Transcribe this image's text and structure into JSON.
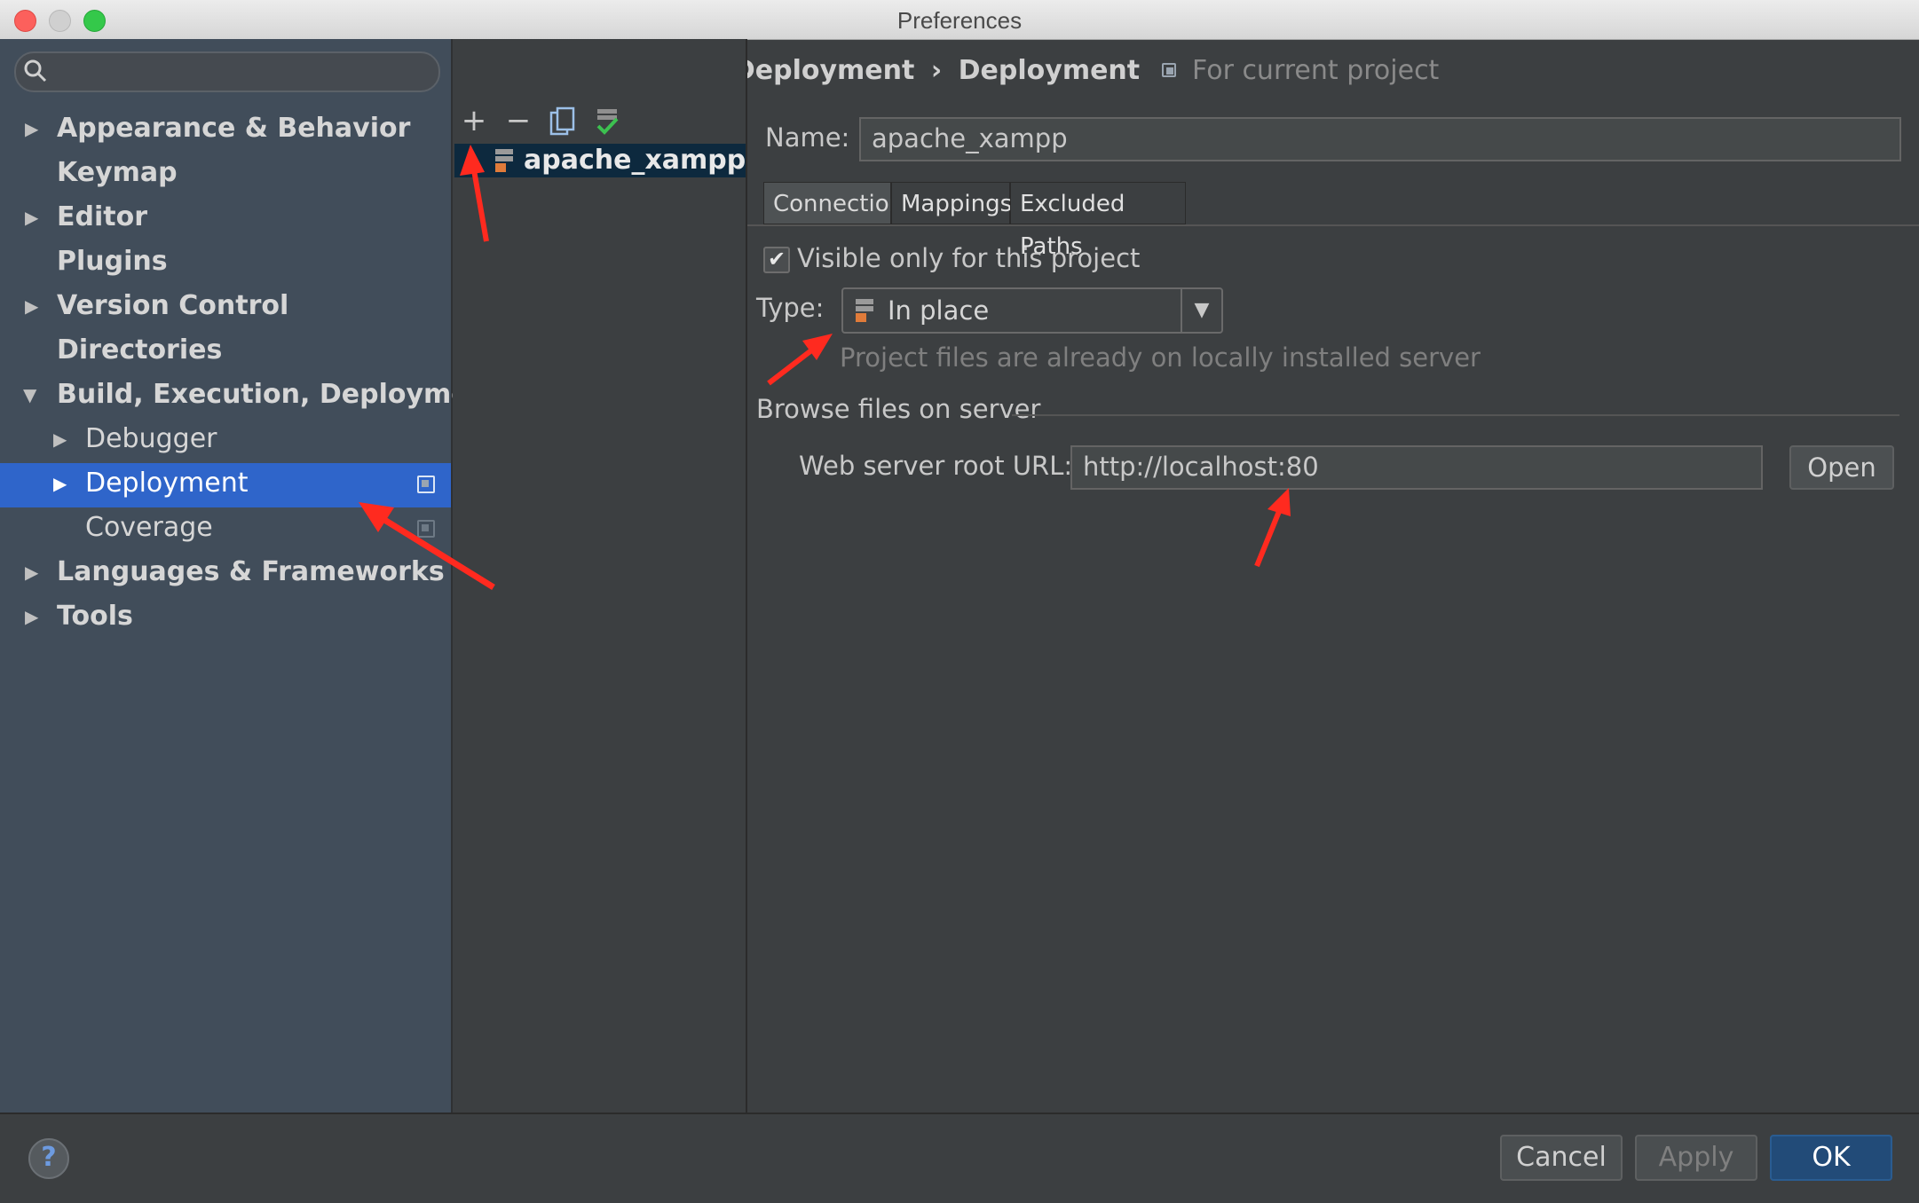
{
  "window": {
    "title": "Preferences"
  },
  "search": {
    "placeholder": ""
  },
  "sidebar": {
    "items": [
      {
        "label": "Appearance & Behavior",
        "expandable": true
      },
      {
        "label": "Keymap",
        "expandable": false
      },
      {
        "label": "Editor",
        "expandable": true
      },
      {
        "label": "Plugins",
        "expandable": false
      },
      {
        "label": "Version Control",
        "expandable": true
      },
      {
        "label": "Directories",
        "expandable": false
      },
      {
        "label": "Build, Execution, Deployment",
        "expandable": true,
        "expanded": true
      },
      {
        "label": "Debugger",
        "expandable": true
      },
      {
        "label": "Deployment",
        "expandable": true,
        "selected": true
      },
      {
        "label": "Coverage",
        "expandable": false
      },
      {
        "label": "Languages & Frameworks",
        "expandable": true
      },
      {
        "label": "Tools",
        "expandable": true
      }
    ]
  },
  "breadcrumb": {
    "parent": "Build, Execution, Deployment",
    "separator": "›",
    "current": "Deployment",
    "scope": "For current project"
  },
  "servers": {
    "toolbar": {
      "add": "+",
      "remove": "−"
    },
    "items": [
      {
        "name": "apache_xampp"
      }
    ]
  },
  "detail": {
    "name_label": "Name:",
    "name_value": "apache_xampp",
    "tabs": [
      {
        "label": "Connection"
      },
      {
        "label": "Mappings"
      },
      {
        "label": "Excluded Paths"
      }
    ],
    "visible_only_label": "Visible only for this project",
    "visible_only_checked": true,
    "type_label": "Type:",
    "type_value": "In place",
    "type_hint": "Project files are already on locally installed server",
    "browse_section": "Browse files on server",
    "web_root_label": "Web server root URL:",
    "web_root_value": "http://localhost:80",
    "open_label": "Open"
  },
  "footer": {
    "help": "?",
    "cancel": "Cancel",
    "apply": "Apply",
    "ok": "OK"
  },
  "colors": {
    "selection": "#2f65ca",
    "annotation": "#ff2a1f",
    "ok_button": "#224b78"
  }
}
